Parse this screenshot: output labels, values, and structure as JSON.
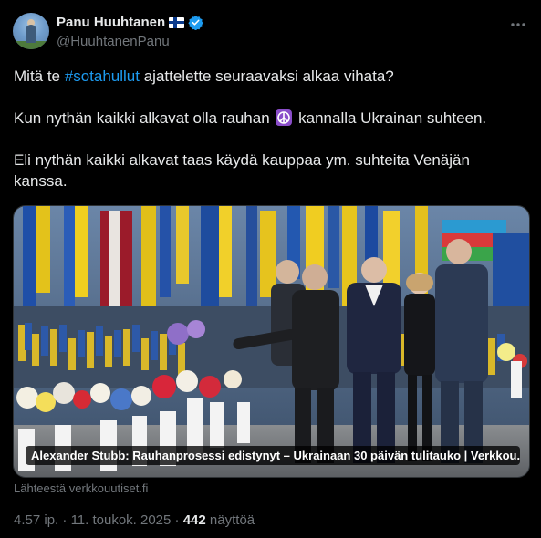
{
  "author": {
    "name": "Panu Huuhtanen",
    "handle": "@HuuhtanenPanu",
    "flag_icon": "finland-flag-icon",
    "verified_icon": "verified-badge-icon"
  },
  "tweet": {
    "line1_pre": "Mitä te ",
    "hashtag": "#sotahullut",
    "line1_post": " ajattelette seuraavaksi alkaa vihata?",
    "line2_pre": "Kun nythän kaikki alkavat olla rauhan ",
    "line2_post": " kannalla Ukrainan suhteen.",
    "line3": "Eli nythän kaikki alkavat taas käydä kauppaa ym. suhteita Venäjän kanssa."
  },
  "link_card": {
    "caption": "Alexander Stubb: Rauhanprosessi edistynyt – Ukrainaan 30 päivän tulitauko | Verkkou...",
    "source": "Lähteestä verkkouutiset.fi"
  },
  "meta": {
    "time": "4.57 ip.",
    "separator": "·",
    "date": "11. toukok. 2025",
    "views": "442",
    "views_label": "näyttöä"
  },
  "colors": {
    "background": "#000000",
    "text": "#e7e9ea",
    "muted": "#71767b",
    "link": "#1d9bf0",
    "verified": "#1d9bf0"
  }
}
